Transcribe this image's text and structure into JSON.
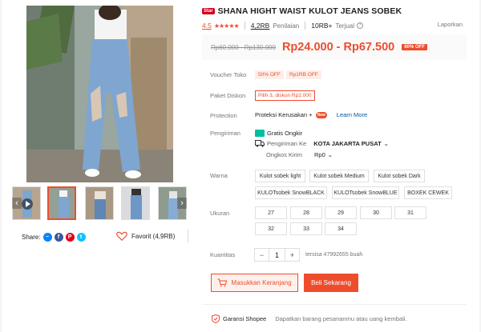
{
  "product": {
    "star_badge": "Star",
    "title": "SHANA HIGHT WAIST KULOT JEANS SOBEK",
    "rating_value": "4.5",
    "rating_stars": 4.5,
    "reviews_count": "4,2RB",
    "reviews_label": "Penilaian",
    "sold_count": "10RB+",
    "sold_label": "Terjual",
    "report_label": "Laporkan"
  },
  "price": {
    "original_range": "Rp60.000 - Rp130.000",
    "current_range": "Rp24.000 - Rp67.500",
    "discount_badge": "60% OFF"
  },
  "voucher": {
    "label": "Voucher Toko",
    "tags": [
      "50% OFF",
      "Rp1RB OFF"
    ]
  },
  "bundle": {
    "label": "Paket Diskon",
    "tag": "Pilih 3, diskon Rp2.000"
  },
  "protection": {
    "label": "Protection",
    "text": "Proteksi Kerusakan +",
    "new_badge": "New",
    "learn_more": "Learn More"
  },
  "shipping": {
    "label": "Pengiriman",
    "free_label": "Gratis Ongkir",
    "to_label": "Pengiriman Ke",
    "to_value": "KOTA JAKARTA PUSAT",
    "cost_label": "Ongkos Kirim",
    "cost_value": "Rp0"
  },
  "variants": {
    "color_label": "Warna",
    "colors": [
      "Kulot sobek light",
      "Kulot sobek Medium",
      "Kulot sobek Dark",
      "KULOTsobek SnowBLACK",
      "KULOTsobek SnowBLUE",
      "BOXEK CEWEK"
    ],
    "size_label": "Ukuran",
    "sizes": [
      "27",
      "28",
      "29",
      "30",
      "31",
      "32",
      "33",
      "34"
    ]
  },
  "quantity": {
    "label": "Kuantitas",
    "minus": "−",
    "value": "1",
    "plus": "+",
    "stock_text": "tersisa 47992655 buah"
  },
  "actions": {
    "add_to_cart": "Masukkan Keranjang",
    "buy_now": "Beli Sekarang"
  },
  "guarantee": {
    "label": "Garansi Shopee",
    "description": "Dapatkan barang pesananmu atau uang kembali."
  },
  "share": {
    "label": "Share:",
    "favorite_label": "Favorit (4,9RB)"
  },
  "colors": {
    "accent": "#ee4d2d",
    "star": "#ee4d2d",
    "messenger": "#0084ff",
    "facebook": "#3b5999",
    "pinterest": "#de0217",
    "twitter": "#10c2ff"
  }
}
